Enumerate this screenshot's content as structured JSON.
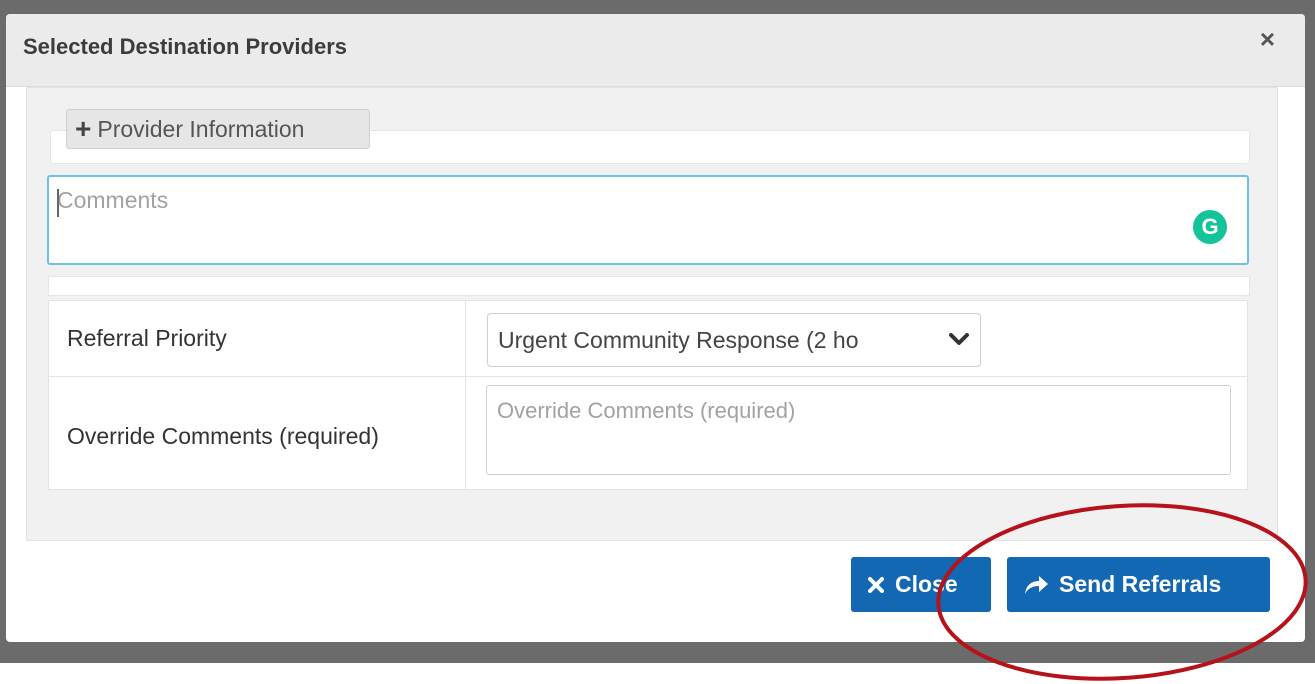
{
  "modal": {
    "title": "Selected Destination Providers",
    "close_glyph": "×"
  },
  "provider": {
    "toggle_label": "Provider Information",
    "toggle_icon": "plus-icon"
  },
  "comments": {
    "placeholder": "Comments",
    "grammarly_badge": "G"
  },
  "form": {
    "referral_priority_label": "Referral Priority",
    "referral_priority_value": "Urgent Community Response (2 ho",
    "override_label": "Override Comments (required)",
    "override_placeholder": "Override Comments (required)"
  },
  "footer": {
    "close_label": "Close",
    "close_icon": "x-icon",
    "send_label": "Send Referrals",
    "send_icon": "share-arrow-icon"
  },
  "colors": {
    "primary": "#1268b3",
    "highlight_ellipse": "#b5121b",
    "grammarly": "#15c39a",
    "focus_border": "#6fc1e0"
  }
}
